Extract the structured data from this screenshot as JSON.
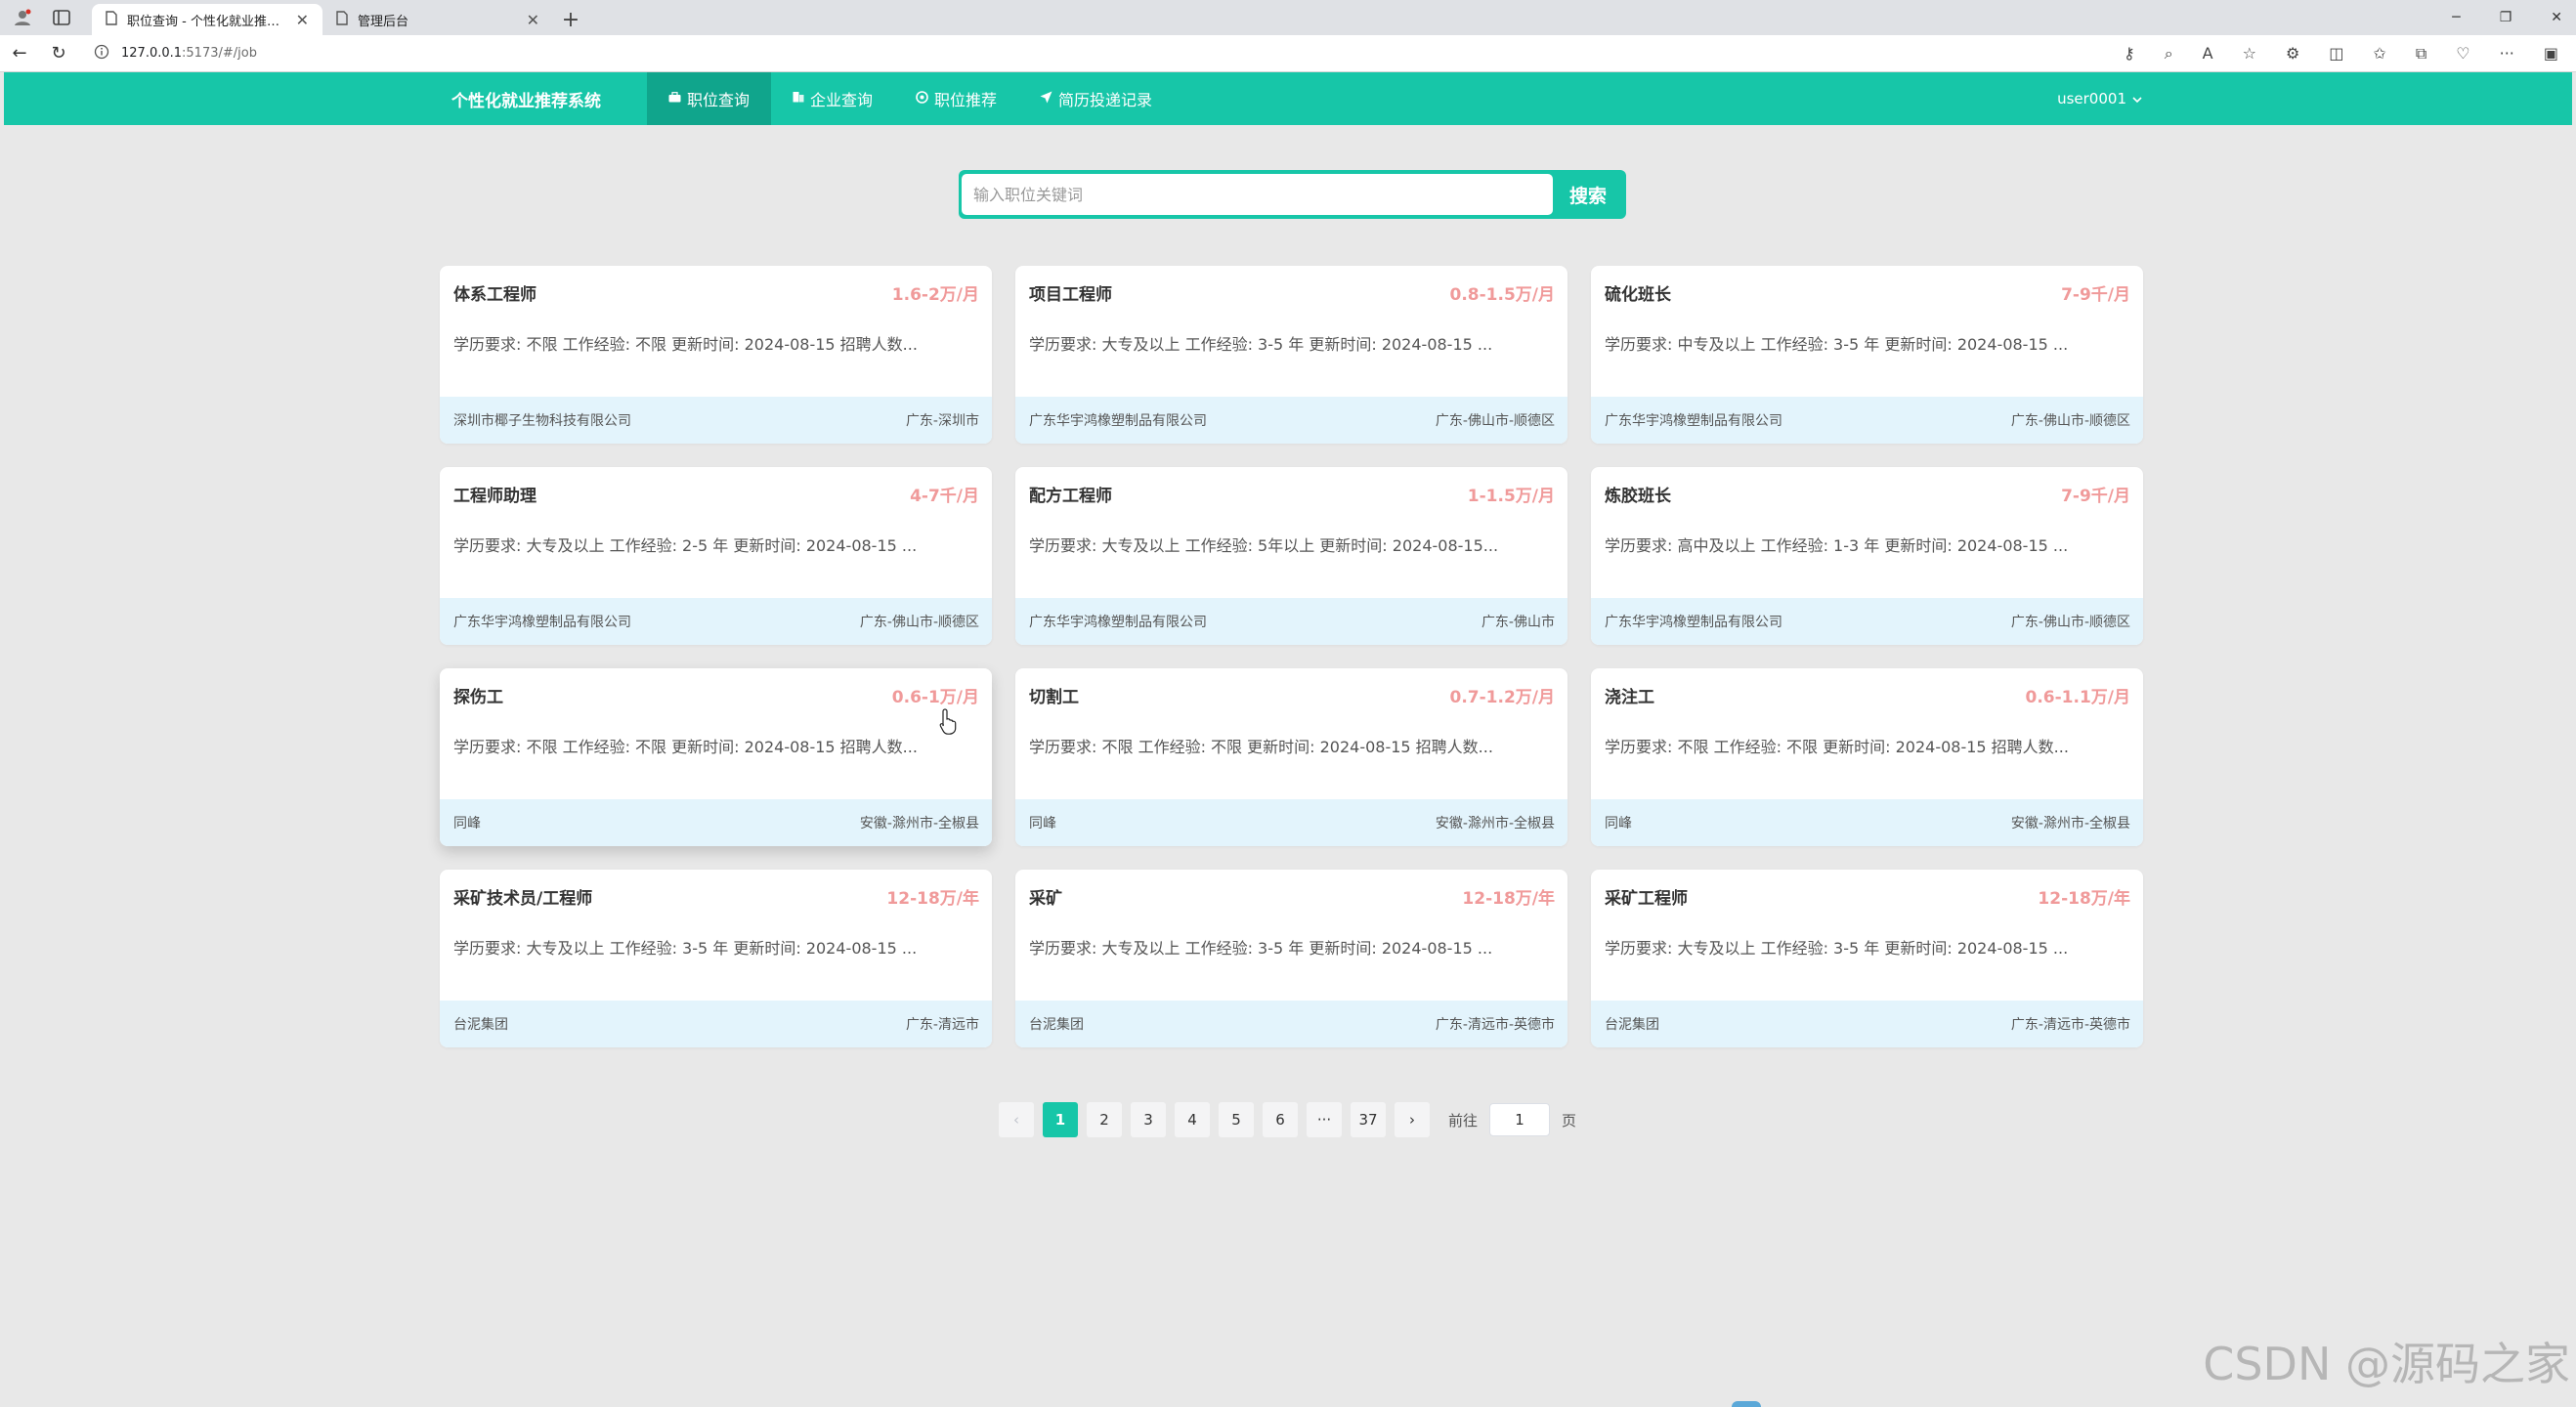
{
  "browser": {
    "tabs": [
      {
        "title": "职位查询 - 个性化就业推荐系统",
        "active": true
      },
      {
        "title": "管理后台",
        "active": false
      }
    ],
    "url_host": "127.0.0.1",
    "url_rest": ":5173/#/job"
  },
  "nav": {
    "brand": "个性化就业推荐系统",
    "items": [
      {
        "label": "职位查询",
        "icon": "briefcase-icon"
      },
      {
        "label": "企业查询",
        "icon": "building-icon"
      },
      {
        "label": "职位推荐",
        "icon": "target-icon"
      },
      {
        "label": "简历投递记录",
        "icon": "send-icon"
      }
    ],
    "user": "user0001"
  },
  "search": {
    "placeholder": "输入职位关键词",
    "button": "搜索"
  },
  "jobs": [
    {
      "title": "体系工程师",
      "salary": "1.6-2万/月",
      "req": "学历要求:  不限 工作经验:  不限 更新时间:  2024-08-15 招聘人数...",
      "company": "深圳市椰子生物科技有限公司",
      "location": "广东-深圳市"
    },
    {
      "title": "项目工程师",
      "salary": "0.8-1.5万/月",
      "req": "学历要求:  大专及以上 工作经验:  3-5 年 更新时间:  2024-08-15 ...",
      "company": "广东华宇鸿橡塑制品有限公司",
      "location": "广东-佛山市-顺德区"
    },
    {
      "title": "硫化班长",
      "salary": "7-9千/月",
      "req": "学历要求:  中专及以上 工作经验:  3-5 年 更新时间:  2024-08-15 ...",
      "company": "广东华宇鸿橡塑制品有限公司",
      "location": "广东-佛山市-顺德区"
    },
    {
      "title": "工程师助理",
      "salary": "4-7千/月",
      "req": "学历要求:  大专及以上 工作经验:  2-5 年 更新时间:  2024-08-15 ...",
      "company": "广东华宇鸿橡塑制品有限公司",
      "location": "广东-佛山市-顺德区"
    },
    {
      "title": "配方工程师",
      "salary": "1-1.5万/月",
      "req": "学历要求:  大专及以上 工作经验:  5年以上 更新时间:  2024-08-15...",
      "company": "广东华宇鸿橡塑制品有限公司",
      "location": "广东-佛山市"
    },
    {
      "title": "炼胶班长",
      "salary": "7-9千/月",
      "req": "学历要求:  高中及以上 工作经验:  1-3 年 更新时间:  2024-08-15 ...",
      "company": "广东华宇鸿橡塑制品有限公司",
      "location": "广东-佛山市-顺德区"
    },
    {
      "title": "探伤工",
      "salary": "0.6-1万/月",
      "req": "学历要求:  不限 工作经验:  不限 更新时间:  2024-08-15 招聘人数...",
      "company": "同峰",
      "location": "安徽-滁州市-全椒县"
    },
    {
      "title": "切割工",
      "salary": "0.7-1.2万/月",
      "req": "学历要求:  不限 工作经验:  不限 更新时间:  2024-08-15 招聘人数...",
      "company": "同峰",
      "location": "安徽-滁州市-全椒县"
    },
    {
      "title": "浇注工",
      "salary": "0.6-1.1万/月",
      "req": "学历要求:  不限 工作经验:  不限 更新时间:  2024-08-15 招聘人数...",
      "company": "同峰",
      "location": "安徽-滁州市-全椒县"
    },
    {
      "title": "采矿技术员/工程师",
      "salary": "12-18万/年",
      "req": "学历要求:  大专及以上 工作经验:  3-5 年 更新时间:  2024-08-15 ...",
      "company": "台泥集团",
      "location": "广东-清远市"
    },
    {
      "title": "采矿",
      "salary": "12-18万/年",
      "req": "学历要求:  大专及以上 工作经验:  3-5 年 更新时间:  2024-08-15 ...",
      "company": "台泥集团",
      "location": "广东-清远市-英德市"
    },
    {
      "title": "采矿工程师",
      "salary": "12-18万/年",
      "req": "学历要求:  大专及以上 工作经验:  3-5 年 更新时间:  2024-08-15 ...",
      "company": "台泥集团",
      "location": "广东-清远市-英德市"
    }
  ],
  "pagination": {
    "prev": "‹",
    "pages": [
      "1",
      "2",
      "3",
      "4",
      "5",
      "6",
      "···",
      "37"
    ],
    "current": "1",
    "next": "›",
    "goto_prefix": "前往",
    "goto_value": "1",
    "goto_suffix": "页"
  },
  "watermark": "CSDN @源码之家",
  "colors": {
    "accent": "#17c6a8",
    "salary": "#f09a9a",
    "card_footer": "#e3f4fc",
    "background": "#e8e8e8"
  }
}
